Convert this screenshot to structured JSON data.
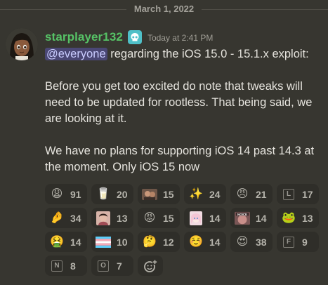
{
  "divider": {
    "date": "March 1, 2022"
  },
  "author": {
    "username": "starplayer132",
    "badge_icon": "skull-icon",
    "timestamp": "Today at 2:41 PM",
    "name_color": "#56c266"
  },
  "message": {
    "mention": "@everyone",
    "line1_rest": " regarding the iOS 15.0 - 15.1.x exploit:",
    "para2": "Before you get too excited do note that tweaks will need to be updated for rootless. That being said, we are looking at it.",
    "para3": "We have no plans for supporting iOS 14 past 14.3 at the moment. Only iOS 15 now"
  },
  "reactions": [
    {
      "emoji": "😩",
      "count": "91",
      "icon": "weary-face-icon"
    },
    {
      "emoji": "🥛",
      "count": "20",
      "icon": "milk-glass-icon"
    },
    {
      "emoji": "",
      "count": "15",
      "icon": "custom-photo-emoji-icon",
      "color": "#8b6a55"
    },
    {
      "emoji": "✨",
      "count": "24",
      "icon": "sparkles-icon"
    },
    {
      "emoji": "😠",
      "count": "21",
      "icon": "angry-horns-icon"
    },
    {
      "emoji": "L",
      "count": "17",
      "icon": "letter-l-icon"
    },
    {
      "emoji": "🤌",
      "count": "34",
      "icon": "pinched-fingers-icon"
    },
    {
      "emoji": "",
      "count": "13",
      "icon": "custom-person-emoji-icon",
      "color": "#c9908a"
    },
    {
      "emoji": "😡",
      "count": "15",
      "icon": "red-face-icon"
    },
    {
      "emoji": "",
      "count": "14",
      "icon": "custom-anime-emoji-icon",
      "color": "#e8c9d6"
    },
    {
      "emoji": "",
      "count": "14",
      "icon": "custom-noice-emoji-icon",
      "color": "#b07a7a",
      "label": "NOICE"
    },
    {
      "emoji": "🐸",
      "count": "13",
      "icon": "frog-icon"
    },
    {
      "emoji": "🤮",
      "count": "14",
      "icon": "vomiting-face-icon"
    },
    {
      "emoji": "",
      "count": "10",
      "icon": "trans-flag-icon"
    },
    {
      "emoji": "🤔",
      "count": "12",
      "icon": "custom-thinking-emoji-icon"
    },
    {
      "emoji": "☺️",
      "count": "14",
      "icon": "smiling-face-icon"
    },
    {
      "emoji": "😍",
      "count": "38",
      "icon": "heart-eyes-icon"
    },
    {
      "emoji": "F",
      "count": "9",
      "icon": "letter-f-icon"
    },
    {
      "emoji": "N",
      "count": "8",
      "icon": "letter-n-icon"
    },
    {
      "emoji": "O",
      "count": "7",
      "icon": "letter-o-icon"
    }
  ],
  "add_reaction_icon": "add-reaction-icon"
}
